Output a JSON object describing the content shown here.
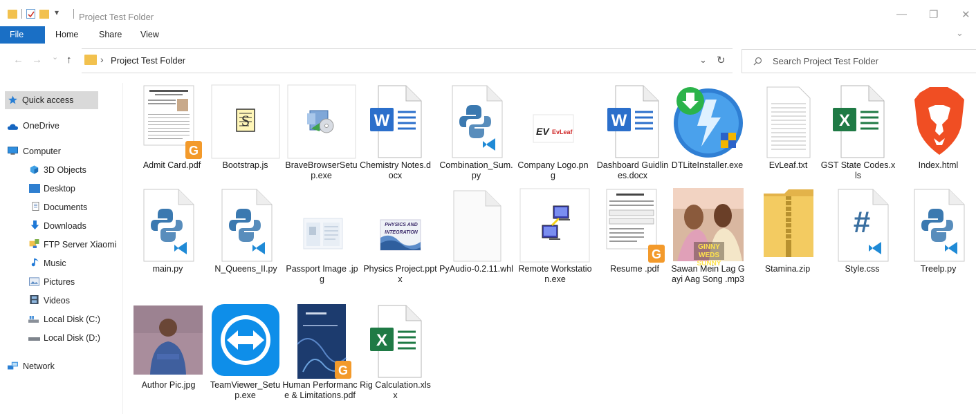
{
  "window": {
    "title": "Project Test Folder",
    "accent": "#1a6fc5",
    "minimize_icon": "—",
    "restore_icon": "❐",
    "close_icon": "✕",
    "expand_ribbon_icon": "⌄"
  },
  "ribbon": {
    "tabs": [
      "File",
      "Home",
      "Share",
      "View"
    ]
  },
  "address": {
    "back_icon": "←",
    "forward_icon": "→",
    "recent_icon": "⌄",
    "up_icon": "↑",
    "separator": "›",
    "crumb": "Project Test Folder",
    "dropdown_icon": "⌄",
    "refresh_icon": "↻"
  },
  "search": {
    "placeholder": "Search Project Test Folder",
    "value": ""
  },
  "sidebar": {
    "items": [
      {
        "label": "Quick access",
        "icon": "star-icon"
      },
      {
        "label": "OneDrive",
        "icon": "cloud-icon"
      },
      {
        "label": "Computer",
        "icon": "computer-icon"
      },
      {
        "label": "3D Objects",
        "icon": "cube-icon"
      },
      {
        "label": "Desktop",
        "icon": "desktop-icon"
      },
      {
        "label": "Documents",
        "icon": "document-icon"
      },
      {
        "label": "Downloads",
        "icon": "download-arrow-icon"
      },
      {
        "label": "FTP Server Xiaomi",
        "icon": "network-location-icon"
      },
      {
        "label": "Music",
        "icon": "music-note-icon"
      },
      {
        "label": "Pictures",
        "icon": "pictures-icon"
      },
      {
        "label": "Videos",
        "icon": "film-icon"
      },
      {
        "label": "Local Disk (C:)",
        "icon": "windows-drive-icon"
      },
      {
        "label": "Local Disk (D:)",
        "icon": "drive-icon"
      },
      {
        "label": "Network",
        "icon": "network-icon"
      }
    ]
  },
  "files": [
    {
      "name": "Admit Card.pdf",
      "icon": "pdf-document-icon"
    },
    {
      "name": "Bootstrap.js",
      "icon": "script-file-icon"
    },
    {
      "name": "BraveBrowserSetup.exe",
      "icon": "installer-icon"
    },
    {
      "name": "Chemistry Notes.docx",
      "icon": "word-icon"
    },
    {
      "name": "Combination_Sum.py",
      "icon": "python-file-icon"
    },
    {
      "name": "Company Logo.png",
      "icon": "image-thumbnail-icon",
      "thumb_text": "EvLeaf"
    },
    {
      "name": "Dashboard Guidlines.docx",
      "icon": "word-icon"
    },
    {
      "name": "DTLiteInstaller.exe",
      "icon": "daemon-tools-icon"
    },
    {
      "name": "EvLeaf.txt",
      "icon": "text-file-icon"
    },
    {
      "name": "GST State Codes.xls",
      "icon": "excel-icon"
    },
    {
      "name": "Index.html",
      "icon": "brave-lion-icon"
    },
    {
      "name": "main.py",
      "icon": "python-file-icon"
    },
    {
      "name": "N_Queens_II.py",
      "icon": "python-file-icon"
    },
    {
      "name": "Passport Image .jpg",
      "icon": "image-thumbnail-icon"
    },
    {
      "name": "Physics Project.pptx",
      "icon": "presentation-thumbnail-icon",
      "thumb_text": "PHYSICS AND INTEGRATION"
    },
    {
      "name": "PyAudio-0.2.11.whl",
      "icon": "blank-file-icon"
    },
    {
      "name": "Remote Workstation.exe",
      "icon": "remote-computers-icon"
    },
    {
      "name": "Resume .pdf",
      "icon": "pdf-document-icon"
    },
    {
      "name": "Sawan Mein Lag Gayi Aag Song .mp3",
      "icon": "album-art-icon",
      "thumb_text": "GINNY WEDS SUNNY"
    },
    {
      "name": "Stamina.zip",
      "icon": "zip-folder-icon"
    },
    {
      "name": "Style.css",
      "icon": "css-file-icon"
    },
    {
      "name": "Treelp.py",
      "icon": "python-file-icon"
    },
    {
      "name": "Author Pic.jpg",
      "icon": "photo-thumbnail-icon"
    },
    {
      "name": "TeamViewer_Setup.exe",
      "icon": "teamviewer-icon"
    },
    {
      "name": "Human Performance & Limitations.pdf",
      "icon": "pdf-document-icon"
    },
    {
      "name": "Rig Calculation.xlsx",
      "icon": "excel-icon"
    }
  ]
}
